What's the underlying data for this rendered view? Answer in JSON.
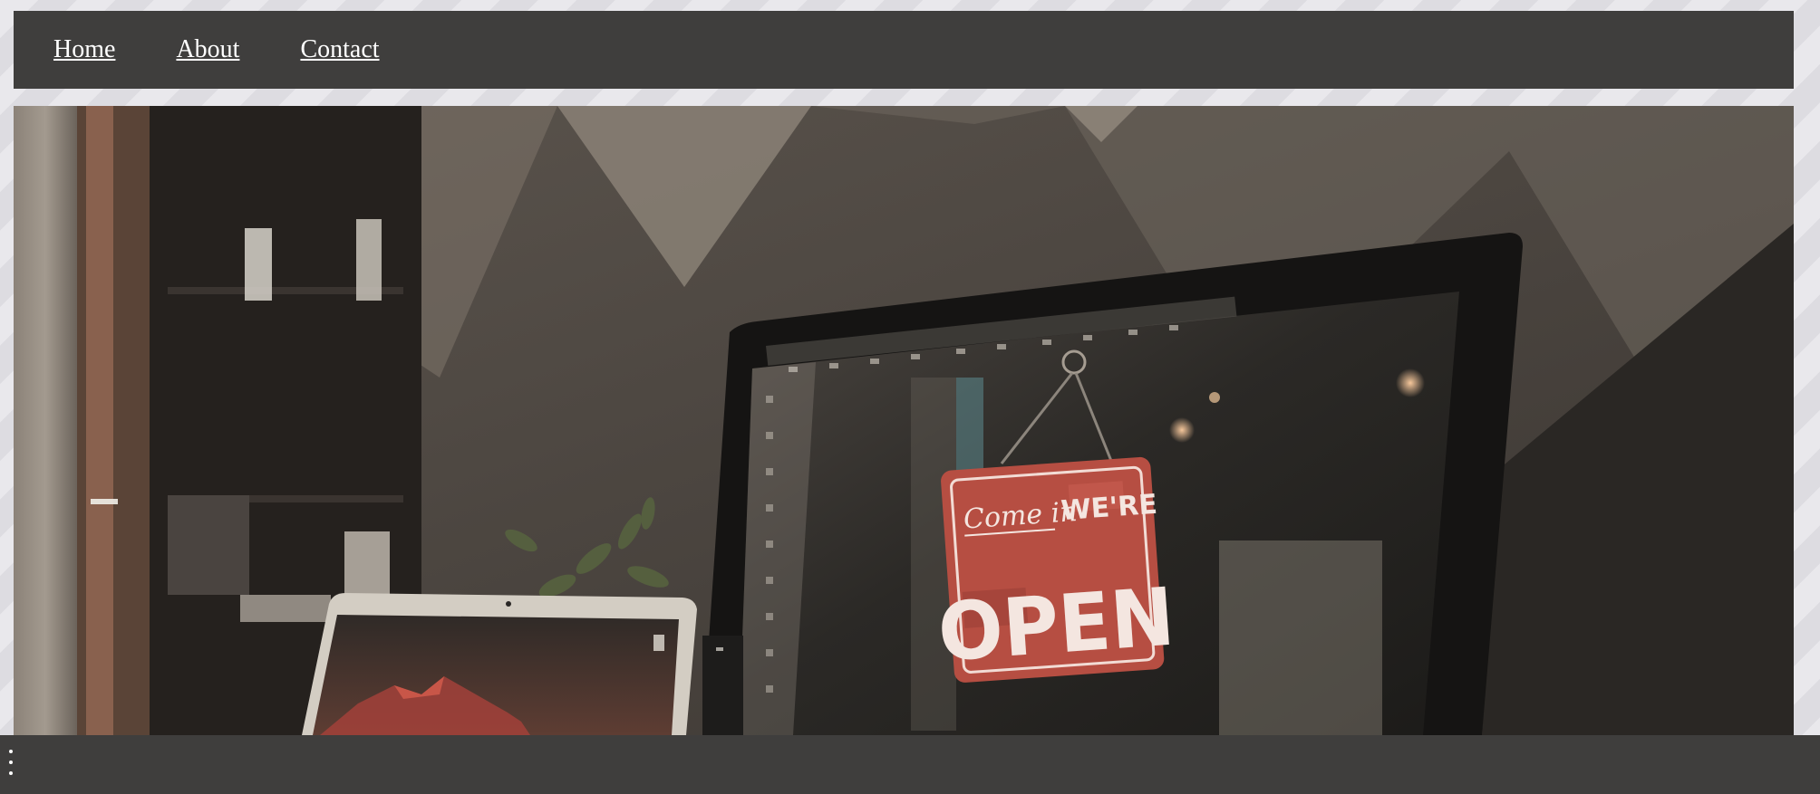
{
  "nav": {
    "links": [
      {
        "label": "Home"
      },
      {
        "label": "About"
      },
      {
        "label": "Contact"
      }
    ]
  },
  "hero": {
    "sign": {
      "script_text": "Come in",
      "were_text": "WE'RE",
      "open_text": "OPEN"
    }
  },
  "colors": {
    "nav_background": "#3f3e3d",
    "page_background": "#e9e8ec",
    "link_color": "#ffffff",
    "sign_red": "#b64e42"
  },
  "bottom_bar": {
    "menu_icon": "kebab-menu-icon"
  }
}
